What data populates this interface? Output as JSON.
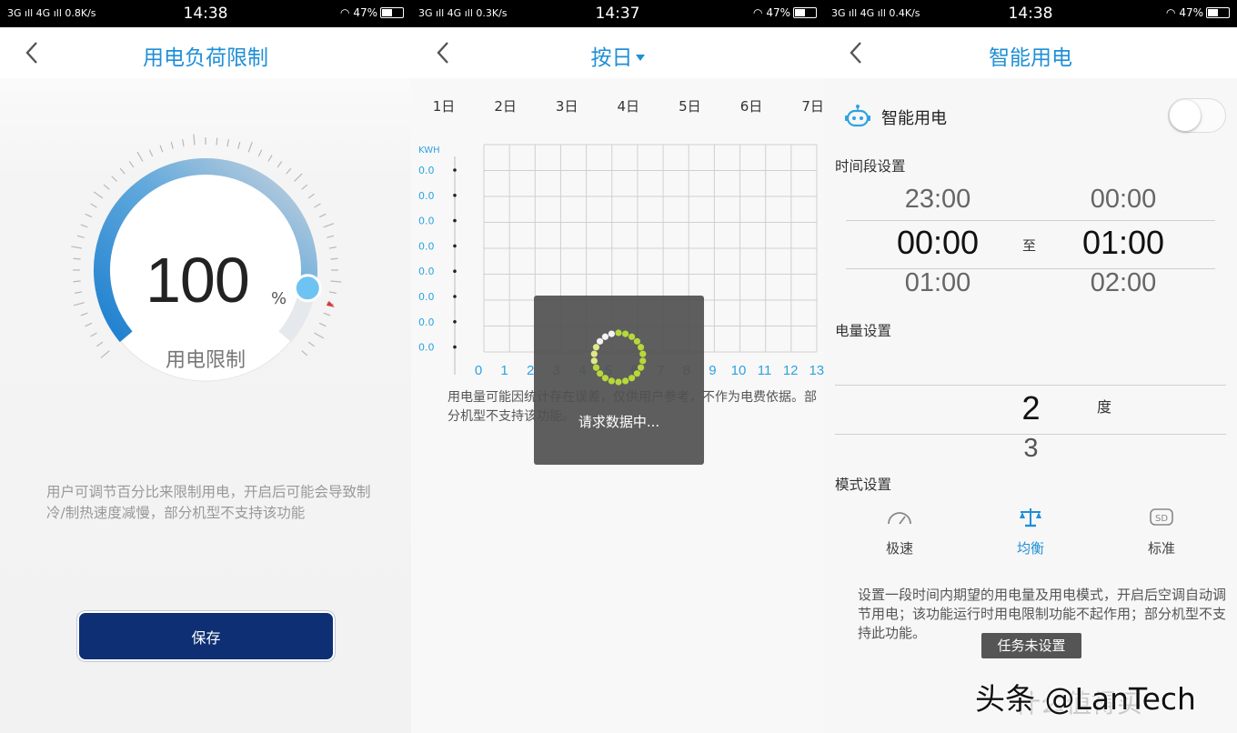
{
  "screens": [
    {
      "status": {
        "network": "3G ıll 4G ıll",
        "speed": "0.8K/s",
        "time": "14:38",
        "battery": "47%"
      },
      "title": "用电负荷限制",
      "gauge": {
        "value": "100",
        "unit": "%",
        "label": "用电限制",
        "level": 1.0
      },
      "description": "用户可调节百分比来限制用电，开启后可能会导致制冷/制热速度减慢，部分机型不支持该功能",
      "save_label": "保存",
      "colors": {
        "accent": "#1f8fd6",
        "button": "#0e2f73"
      }
    },
    {
      "status": {
        "network": "3G ıll 4G ıll",
        "speed": "0.3K/s",
        "time": "14:37",
        "battery": "47%"
      },
      "title": "按日",
      "days": [
        "1日",
        "2日",
        "3日",
        "4日",
        "5日",
        "6日",
        "7日"
      ],
      "description": "用电量可能因统计存在误差，仅供用户参考，不作为电费依据。部分机型不支持该功能。",
      "loading_text": "请求数据中...",
      "chart_data": {
        "type": "bar",
        "ylabel": "KWH",
        "y_ticks": [
          "0.0",
          "0.0",
          "0.0",
          "0.0",
          "0.0",
          "0.0",
          "0.0",
          "0.0"
        ],
        "categories": [
          "0",
          "1",
          "2",
          "3",
          "4",
          "5",
          "6",
          "7",
          "8",
          "9",
          "10",
          "11",
          "12",
          "13"
        ],
        "values": [
          0,
          0,
          0,
          0,
          0,
          0,
          0,
          0,
          0,
          0,
          0,
          0,
          0,
          0
        ],
        "grid": true
      }
    },
    {
      "status": {
        "network": "3G ıll 4G ıll",
        "speed": "0.4K/s",
        "time": "14:38",
        "battery": "47%"
      },
      "title": "智能用电",
      "smart_label": "智能用电",
      "smart_enabled": false,
      "time_section": "时间段设置",
      "start_times": {
        "prev": "23:00",
        "selected": "00:00",
        "next": "01:00"
      },
      "to_label": "至",
      "end_times": {
        "prev": "00:00",
        "selected": "01:00",
        "next": "02:00"
      },
      "amount_section": "电量设置",
      "amount": {
        "selected": "2",
        "next": "3",
        "unit": "度"
      },
      "mode_section": "模式设置",
      "modes": [
        {
          "label": "极速",
          "icon": "speedometer-icon",
          "active": false
        },
        {
          "label": "均衡",
          "icon": "balance-icon",
          "active": true
        },
        {
          "label": "标准",
          "icon": "sd-icon",
          "active": false
        }
      ],
      "description": "设置一段时间内期望的用电量及用电模式，开启后空调自动调节用电；该功能运行时用电限制功能不起作用；部分机型不支持此功能。",
      "toast": "任务未设置"
    }
  ],
  "watermark": "头条 @LanTech",
  "watermark_faint": "什么值得买"
}
